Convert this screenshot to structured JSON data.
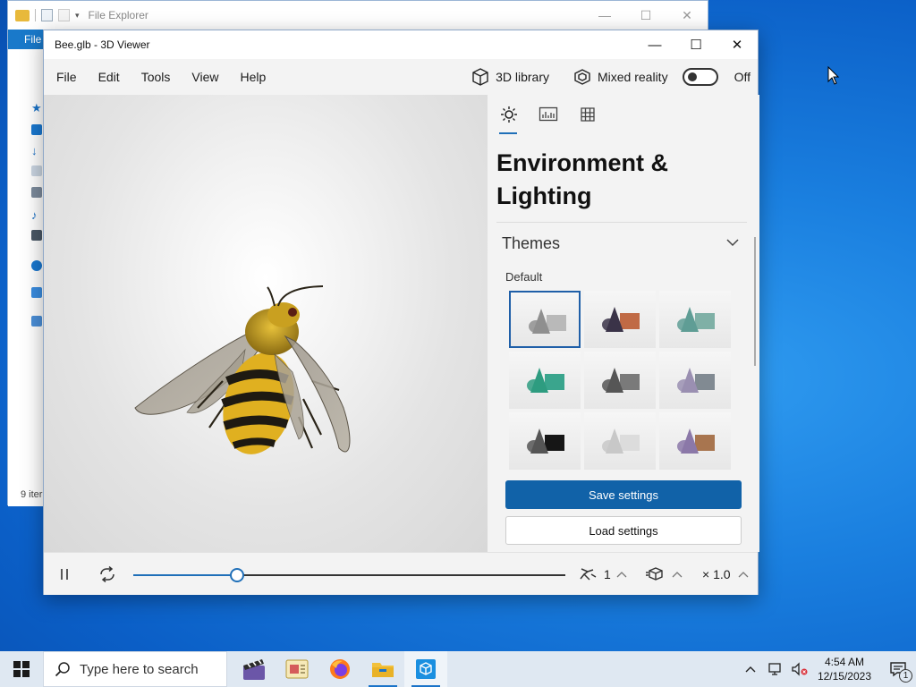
{
  "file_explorer": {
    "title": "File Explorer",
    "ribbon_tab": "File",
    "status": "9 iter"
  },
  "viewer": {
    "title": "Bee.glb - 3D Viewer",
    "menu": [
      "File",
      "Edit",
      "Tools",
      "View",
      "Help"
    ],
    "library_label": "3D library",
    "mixed_reality_label": "Mixed reality",
    "mixed_reality_state": "Off",
    "panel": {
      "title": "Environment & Lighting",
      "section": "Themes",
      "selected_theme": "Default",
      "save_label": "Save settings",
      "load_label": "Load settings",
      "themes": [
        {
          "name": "Default",
          "cone": "#8f8f8f",
          "box": "#b9b9b9"
        },
        {
          "name": "theme-2",
          "cone": "#3a3348",
          "box": "#c06a45"
        },
        {
          "name": "theme-3",
          "cone": "#5f9d95",
          "box": "#7fb0a6"
        },
        {
          "name": "theme-4",
          "cone": "#2e9c80",
          "box": "#3aa58d"
        },
        {
          "name": "theme-5",
          "cone": "#565656",
          "box": "#7a7a7a"
        },
        {
          "name": "theme-6",
          "cone": "#9a8fb1",
          "box": "#818a92"
        },
        {
          "name": "theme-7",
          "cone": "#555555",
          "box": "#161616"
        },
        {
          "name": "theme-8",
          "cone": "#c8c8c8",
          "box": "#dcdcdc"
        },
        {
          "name": "theme-9",
          "cone": "#8b78a8",
          "box": "#a8754f"
        }
      ]
    },
    "playback": {
      "progress": 0.24,
      "speed_count": "1",
      "playback_speed": "× 1.0"
    }
  },
  "taskbar": {
    "search_placeholder": "Type here to search",
    "time": "4:54 AM",
    "date": "12/15/2023",
    "notification_count": "1"
  },
  "colors": {
    "accent": "#1162a8",
    "desktop": "#1a7fdf"
  }
}
